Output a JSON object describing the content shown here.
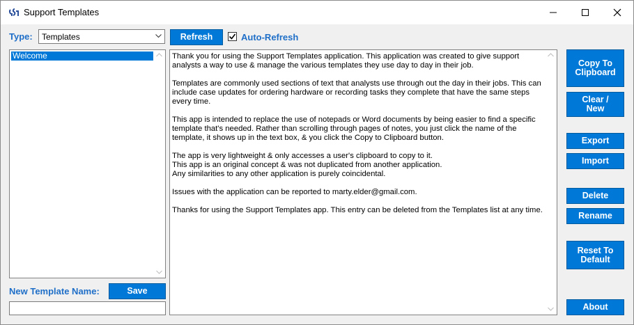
{
  "window": {
    "title": "Support Templates"
  },
  "type_selector": {
    "label": "Type:",
    "selected": "Templates"
  },
  "toolbar": {
    "refresh_label": "Refresh",
    "auto_refresh_label": "Auto-Refresh",
    "auto_refresh_checked": true
  },
  "templates_list": {
    "items": [
      "Welcome"
    ],
    "selected_index": 0
  },
  "new_template": {
    "label": "New Template Name:",
    "save_label": "Save",
    "value": ""
  },
  "template_text": {
    "paragraphs": [
      "Thank you for using the Support Templates application.  This application was created to give support analysts a way to use & manage the various templates they use day to day in their job.",
      "Templates are commonly used sections of text that analysts use through out the day in their jobs.  This can include case updates for ordering hardware or recording tasks they complete that have the same steps every time.",
      "This app is intended to replace the use of notepads or Word documents by being easier to find a specific template that's needed.  Rather than scrolling through pages of notes, you just click the name of the template, it shows up in the text box, & you click the Copy to Clipboard button.",
      "The app is very lightweight & only accesses a user's clipboard to copy to it.\nThis app is an original concept & was not duplicated from another application.\nAny similarities to any other application is purely coincidental.",
      "Issues with the application can be reported to marty.elder@gmail.com.",
      "Thanks for using the Support Templates app.  This entry can be deleted from the Templates list at any time."
    ]
  },
  "actions": {
    "copy_label": "Copy To Clipboard",
    "clear_label": "Clear / New",
    "export_label": "Export",
    "import_label": "Import",
    "delete_label": "Delete",
    "rename_label": "Rename",
    "reset_label": "Reset To Default",
    "about_label": "About"
  },
  "colors": {
    "accent": "#0078d7",
    "label_blue": "#1f6fc8"
  }
}
